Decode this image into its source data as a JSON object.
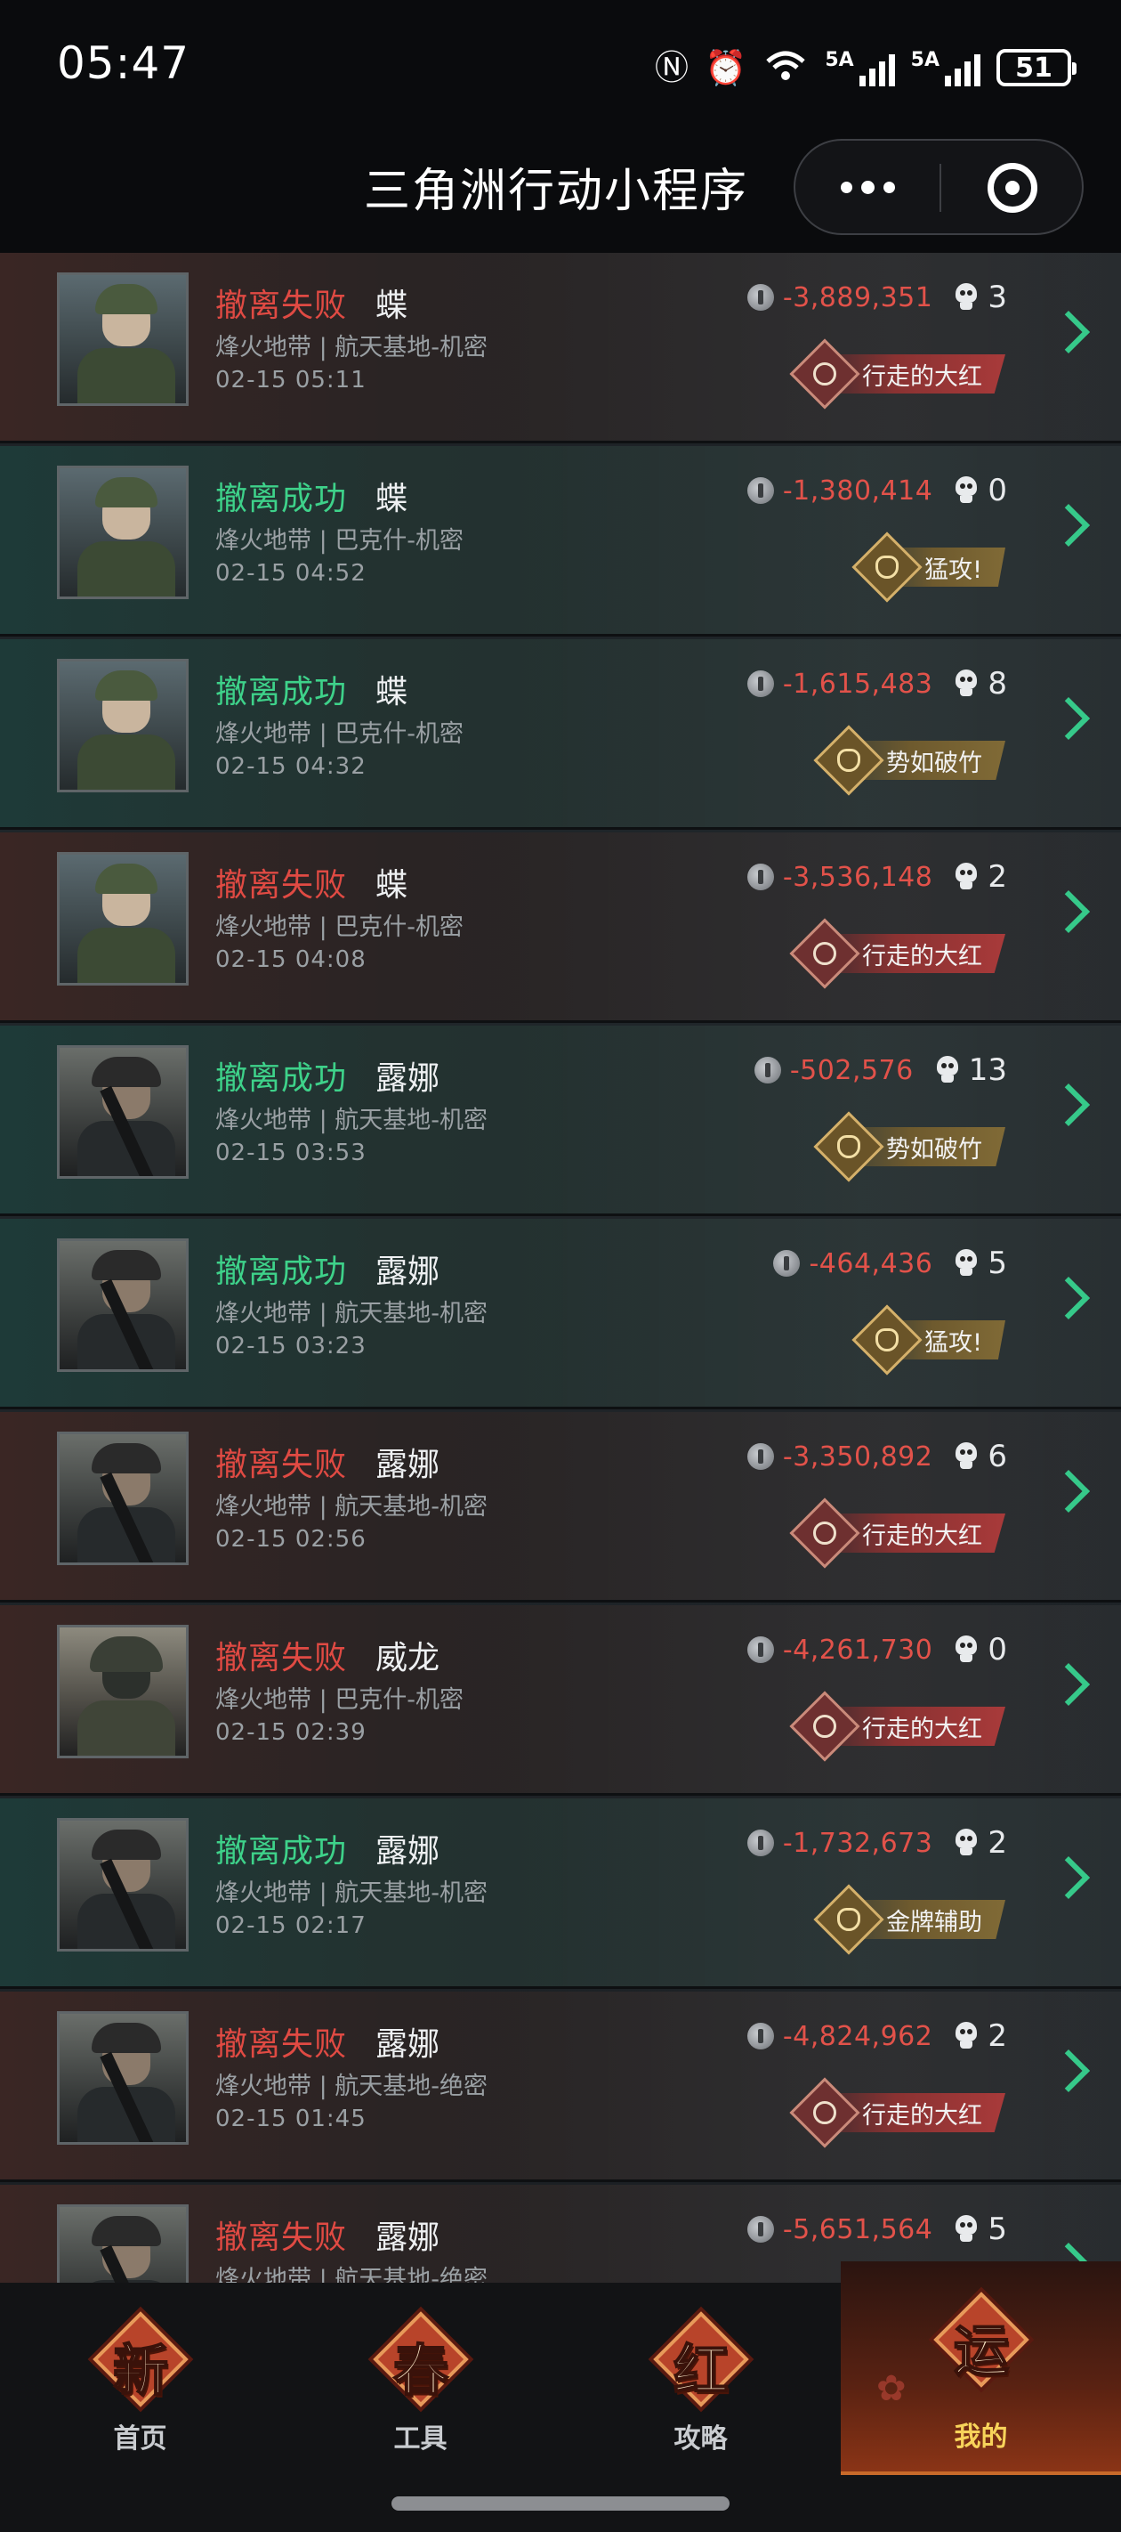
{
  "status_bar": {
    "time": "05:47",
    "battery": "51",
    "signal1_label": "5A",
    "signal2_label": "5A",
    "wifi_label": "6"
  },
  "title_bar": {
    "title": "三角洲行动小程序"
  },
  "matches": [
    {
      "result": "撤离失败",
      "result_type": "fail",
      "operator": "蝶",
      "map": "烽火地带 | 航天基地-机密",
      "datetime": "02-15 05:11",
      "value": "-3,889,351",
      "kills": "3",
      "badge": "行走的大红",
      "badge_type": "red",
      "avatar": "butterfly"
    },
    {
      "result": "撤离成功",
      "result_type": "success",
      "operator": "蝶",
      "map": "烽火地带 | 巴克什-机密",
      "datetime": "02-15 04:52",
      "value": "-1,380,414",
      "kills": "0",
      "badge": "猛攻!",
      "badge_type": "gold",
      "avatar": "butterfly"
    },
    {
      "result": "撤离成功",
      "result_type": "success",
      "operator": "蝶",
      "map": "烽火地带 | 巴克什-机密",
      "datetime": "02-15 04:32",
      "value": "-1,615,483",
      "kills": "8",
      "badge": "势如破竹",
      "badge_type": "gold",
      "avatar": "butterfly"
    },
    {
      "result": "撤离失败",
      "result_type": "fail",
      "operator": "蝶",
      "map": "烽火地带 | 巴克什-机密",
      "datetime": "02-15 04:08",
      "value": "-3,536,148",
      "kills": "2",
      "badge": "行走的大红",
      "badge_type": "red",
      "avatar": "butterfly"
    },
    {
      "result": "撤离成功",
      "result_type": "success",
      "operator": "露娜",
      "map": "烽火地带 | 航天基地-机密",
      "datetime": "02-15 03:53",
      "value": "-502,576",
      "kills": "13",
      "badge": "势如破竹",
      "badge_type": "gold",
      "avatar": "luna"
    },
    {
      "result": "撤离成功",
      "result_type": "success",
      "operator": "露娜",
      "map": "烽火地带 | 航天基地-机密",
      "datetime": "02-15 03:23",
      "value": "-464,436",
      "kills": "5",
      "badge": "猛攻!",
      "badge_type": "gold",
      "avatar": "luna"
    },
    {
      "result": "撤离失败",
      "result_type": "fail",
      "operator": "露娜",
      "map": "烽火地带 | 航天基地-机密",
      "datetime": "02-15 02:56",
      "value": "-3,350,892",
      "kills": "6",
      "badge": "行走的大红",
      "badge_type": "red",
      "avatar": "luna"
    },
    {
      "result": "撤离失败",
      "result_type": "fail",
      "operator": "威龙",
      "map": "烽火地带 | 巴克什-机密",
      "datetime": "02-15 02:39",
      "value": "-4,261,730",
      "kills": "0",
      "badge": "行走的大红",
      "badge_type": "red",
      "avatar": "weilong"
    },
    {
      "result": "撤离成功",
      "result_type": "success",
      "operator": "露娜",
      "map": "烽火地带 | 航天基地-机密",
      "datetime": "02-15 02:17",
      "value": "-1,732,673",
      "kills": "2",
      "badge": "金牌辅助",
      "badge_type": "gold",
      "avatar": "luna"
    },
    {
      "result": "撤离失败",
      "result_type": "fail",
      "operator": "露娜",
      "map": "烽火地带 | 航天基地-绝密",
      "datetime": "02-15 01:45",
      "value": "-4,824,962",
      "kills": "2",
      "badge": "行走的大红",
      "badge_type": "red",
      "avatar": "luna"
    },
    {
      "result": "撤离失败",
      "result_type": "fail",
      "operator": "露娜",
      "map": "烽火地带 | 航天基地-绝密",
      "datetime": "",
      "value": "-5,651,564",
      "kills": "5",
      "badge": "",
      "badge_type": "red",
      "avatar": "luna"
    }
  ],
  "tab_bar": {
    "tabs": [
      {
        "glyph": "新",
        "label": "首页",
        "active": false
      },
      {
        "glyph": "春",
        "label": "工具",
        "active": false
      },
      {
        "glyph": "红",
        "label": "攻略",
        "active": false
      },
      {
        "glyph": "运",
        "label": "我的",
        "active": true
      }
    ]
  },
  "colors": {
    "fail": "#e04a43",
    "success": "#3ed28a",
    "value": "#e2524a",
    "chevron": "#36c98a",
    "active_tab_label": "#f7d35a"
  }
}
